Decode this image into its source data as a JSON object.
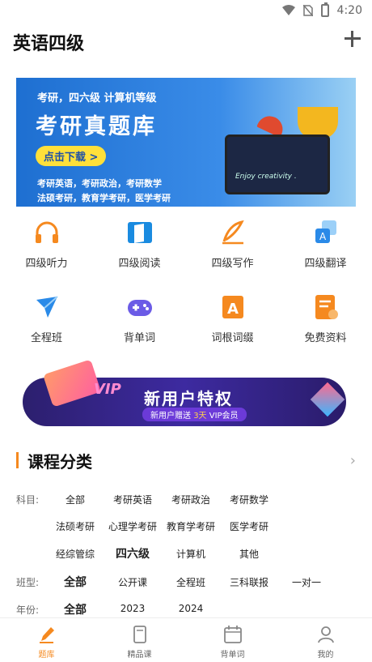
{
  "status": {
    "time": "4:20"
  },
  "header": {
    "title": "英语四级"
  },
  "banner": {
    "subtitle": "考研，四六级  计算机等级",
    "title": "考研真题库",
    "download_label": "点击下载 >",
    "line1": "考研英语，考研政治，考研数学",
    "line2": "法硕考研，教育学考研，医学考研",
    "monitor_text": "Enjoy creativity ."
  },
  "grid_row1": [
    {
      "label": "四级听力",
      "icon": "headphones-icon",
      "color": "#f5891f"
    },
    {
      "label": "四级阅读",
      "icon": "book-icon",
      "color": "#1a8be0"
    },
    {
      "label": "四级写作",
      "icon": "quill-icon",
      "color": "#f5891f"
    },
    {
      "label": "四级翻译",
      "icon": "translate-icon",
      "color": "#2a8ae8"
    }
  ],
  "grid_row2": [
    {
      "label": "全程班",
      "icon": "paper-plane-icon",
      "color": "#2a8ae8"
    },
    {
      "label": "背单词",
      "icon": "gamepad-icon",
      "color": "#6b5be6"
    },
    {
      "label": "词根词缀",
      "icon": "letter-a-icon",
      "color": "#f5891f"
    },
    {
      "label": "免费资料",
      "icon": "document-icon",
      "color": "#f5891f"
    }
  ],
  "promo": {
    "vip_text": "VIP",
    "title": "新用户特权",
    "sub_prefix": "新用户赠送 ",
    "sub_highlight": "3天",
    "sub_suffix": " VIP会员"
  },
  "section": {
    "title": "课程分类",
    "more": "›"
  },
  "filters": {
    "subject_key": "科目:",
    "subject_options": [
      "全部",
      "考研英语",
      "考研政治",
      "考研数学",
      "法硕考研",
      "心理学考研",
      "教育学考研",
      "医学考研",
      "经综管综",
      "四六级",
      "计算机",
      "其他"
    ],
    "class_key": "班型:",
    "class_options": [
      "全部",
      "公开课",
      "全程班",
      "三科联报",
      "一对一"
    ],
    "year_key": "年份:",
    "year_options": [
      "全部",
      "2023",
      "2024"
    ]
  },
  "bottom_nav": [
    {
      "label": "题库",
      "icon": "pencil-icon",
      "active": true
    },
    {
      "label": "精品课",
      "icon": "course-book-icon",
      "active": false
    },
    {
      "label": "背单词",
      "icon": "calendar-icon",
      "active": false
    },
    {
      "label": "我的",
      "icon": "user-icon",
      "active": false
    }
  ],
  "colors": {
    "accent": "#f5891f",
    "banner_blue": "#1e6fd1"
  }
}
